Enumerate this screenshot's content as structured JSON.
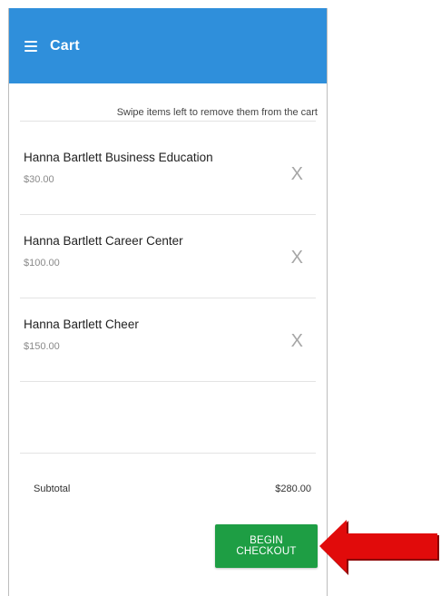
{
  "header": {
    "title": "Cart",
    "menu_icon": "hamburger-menu-icon"
  },
  "hint": "Swipe items left to remove them from the cart",
  "cart": {
    "items": [
      {
        "name": "Hanna Bartlett Business Education",
        "price": "$30.00",
        "remove": "X"
      },
      {
        "name": "Hanna Bartlett Career Center",
        "price": "$100.00",
        "remove": "X"
      },
      {
        "name": "Hanna Bartlett Cheer",
        "price": "$150.00",
        "remove": "X"
      }
    ]
  },
  "summary": {
    "subtotal_label": "Subtotal",
    "subtotal_value": "$280.00"
  },
  "checkout": {
    "label": "BEGIN CHECKOUT"
  },
  "colors": {
    "header": "#2f8fdb",
    "checkout": "#1e9e44",
    "annotation_arrow": "#e10b0b"
  }
}
